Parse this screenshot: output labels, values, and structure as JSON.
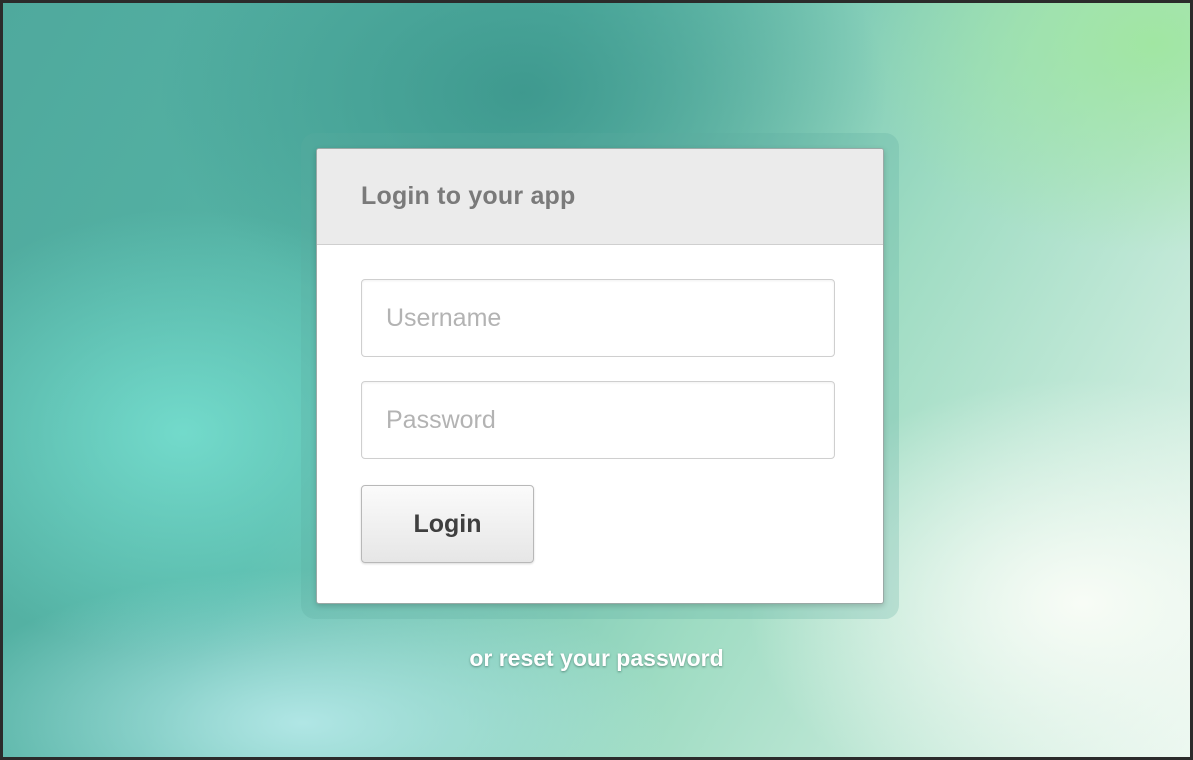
{
  "login_panel": {
    "title": "Login to your app",
    "username": {
      "value": "",
      "placeholder": "Username"
    },
    "password": {
      "value": "",
      "placeholder": "Password"
    },
    "login_button_label": "Login"
  },
  "reset_link_text": "or reset your password",
  "colors": {
    "header_background": "#ebebeb",
    "panel_background": "#ffffff",
    "background_teal": "#56b5a6",
    "background_light": "#e8f6ee"
  }
}
